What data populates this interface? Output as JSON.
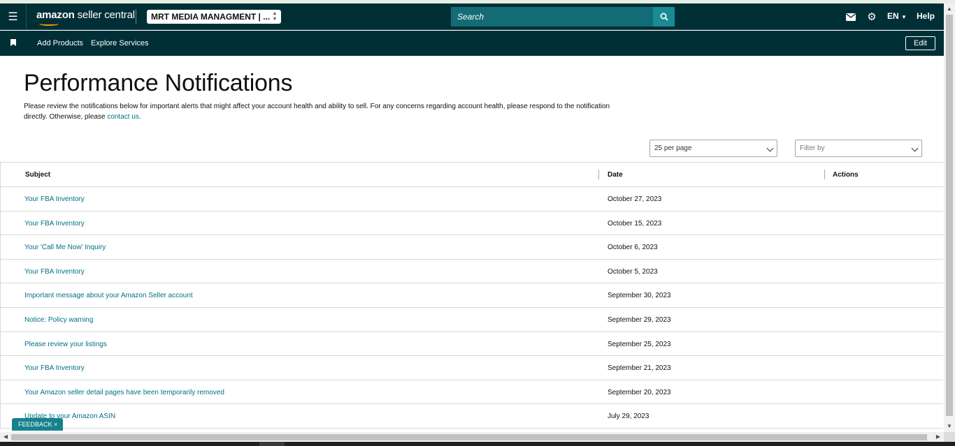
{
  "header": {
    "brand_bold": "amazon",
    "brand_light": " seller central",
    "account": "MRT MEDIA MANAGMENT | ...",
    "search_placeholder": "Search",
    "language": "EN",
    "help": "Help"
  },
  "nav": {
    "links": [
      "Add Products",
      "Explore Services"
    ],
    "edit_label": "Edit"
  },
  "page": {
    "title": "Performance Notifications",
    "description": "Please review the notifications below for important alerts that might affect your account health and ability to sell. For any concerns regarding account health, please respond to the notification directly. Otherwise, please ",
    "contact_link": "contact us.",
    "per_page": "25 per page",
    "filter_placeholder": "Filter by"
  },
  "table": {
    "columns": [
      "Subject",
      "Date",
      "Actions"
    ],
    "rows": [
      {
        "subject": "Your FBA Inventory",
        "date": "October 27, 2023"
      },
      {
        "subject": "Your FBA Inventory",
        "date": "October 15, 2023"
      },
      {
        "subject": "Your 'Call Me Now' Inquiry",
        "date": "October 6, 2023"
      },
      {
        "subject": "Your FBA Inventory",
        "date": "October 5, 2023"
      },
      {
        "subject": "Important message about your Amazon Seller account",
        "date": "September 30, 2023"
      },
      {
        "subject": "Notice: Policy warning",
        "date": "September 29, 2023"
      },
      {
        "subject": "Please review your listings",
        "date": "September 25, 2023"
      },
      {
        "subject": "Your FBA Inventory",
        "date": "September 21, 2023"
      },
      {
        "subject": "Your Amazon seller detail pages have been temporarily removed",
        "date": "September 20, 2023"
      },
      {
        "subject": "Update to your Amazon ASIN",
        "date": "July 29, 2023"
      }
    ]
  },
  "feedback": {
    "label": "FEEDBACK",
    "close": "×"
  },
  "icons": [
    "menu-icon",
    "search-icon",
    "mail-icon",
    "gear-icon",
    "bookmark-icon",
    "chevron-down-icon",
    "close-icon"
  ],
  "colors": {
    "header_bg": "#002f36",
    "link": "#007185",
    "search_bg": "#136c75",
    "feedback_bg": "#16828c"
  }
}
